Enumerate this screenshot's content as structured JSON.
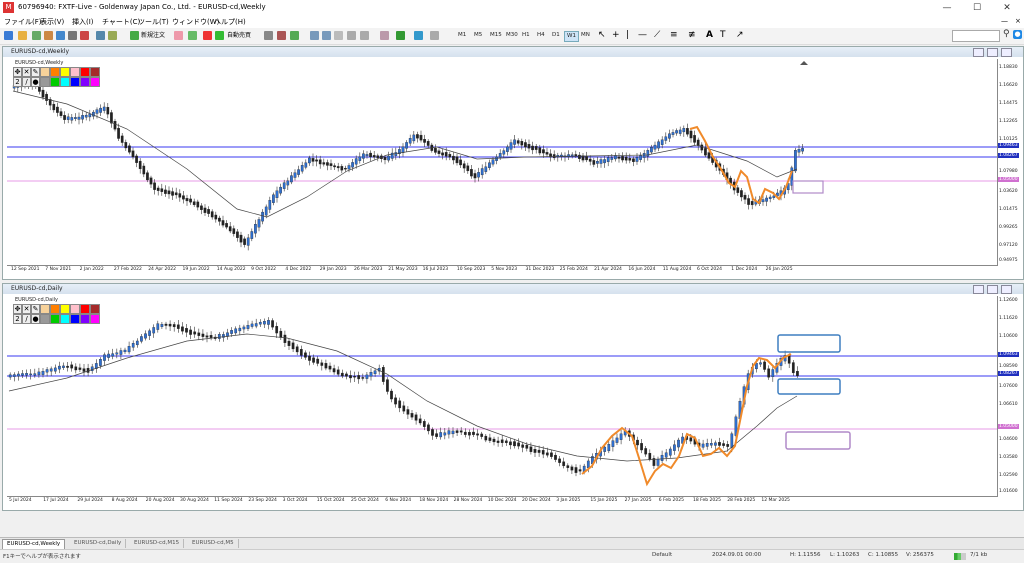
{
  "window": {
    "title": "60796940: FXTF-Live - Goldenway Japan Co., Ltd. - EURUSD-cd,Weekly",
    "controls": [
      "—",
      "☐",
      "✕"
    ]
  },
  "menu": [
    "ファイル(F)",
    "表示(V)",
    "挿入(I)",
    "チャート(C)",
    "ツール(T)",
    "ウィンドウ(W)",
    "ヘルプ(H)"
  ],
  "toolbar": {
    "new_order": "新規注文",
    "auto_trade": "自動売買",
    "timeframes": [
      "M1",
      "M5",
      "M15",
      "M30",
      "H1",
      "H4",
      "D1",
      "W1",
      "MN"
    ],
    "active_timeframe": "W1"
  },
  "weekly": {
    "window_title": "EURUSD-cd,Weekly",
    "symbol_label": "EURUSD-cd,Weekly",
    "price_ticks": [
      "1.18830",
      "1.16620",
      "1.14475",
      "1.12265",
      "1.10125",
      "1.07980",
      "1.05620",
      "1.03620",
      "1.01475",
      "0.99265",
      "0.97120",
      "0.94975"
    ],
    "price_tags": [
      {
        "value": "1.09463",
        "color": "#1f2fbf"
      },
      {
        "value": "1.08267",
        "color": "#1f2fbf"
      },
      {
        "value": "1.05000",
        "color": "#d070d0"
      }
    ],
    "date_ticks": [
      "12 Sep 2021",
      "7 Nov 2021",
      "2 Jan 2022",
      "27 Feb 2022",
      "24 Apr 2022",
      "19 Jun 2022",
      "14 Aug 2022",
      "9 Oct 2022",
      "4 Dec 2022",
      "29 Jan 2023",
      "26 Mar 2023",
      "21 May 2023",
      "16 Jul 2023",
      "10 Sep 2023",
      "5 Nov 2023",
      "31 Dec 2023",
      "25 Feb 2024",
      "21 Apr 2024",
      "16 Jun 2024",
      "11 Aug 2024",
      "6 Oct 2024",
      "1 Dec 2024",
      "26 Jan 2025"
    ]
  },
  "daily": {
    "window_title": "EURUSD-cd,Daily",
    "symbol_label": "EURUSD-cd,Daily",
    "price_ticks": [
      "1.12600",
      "1.11620",
      "1.10600",
      "1.09580",
      "1.08590",
      "1.07600",
      "1.06610",
      "1.05600",
      "1.04600",
      "1.03580",
      "1.02590",
      "1.01600"
    ],
    "price_tags": [
      {
        "value": "1.09463",
        "color": "#1f2fbf"
      },
      {
        "value": "1.08267",
        "color": "#1f2fbf"
      },
      {
        "value": "1.05000",
        "color": "#d070d0"
      }
    ],
    "date_ticks": [
      "5 Jul 2024",
      "17 Jul 2024",
      "29 Jul 2024",
      "8 Aug 2024",
      "20 Aug 2024",
      "30 Aug 2024",
      "11 Sep 2024",
      "23 Sep 2024",
      "3 Oct 2024",
      "15 Oct 2024",
      "25 Oct 2024",
      "6 Nov 2024",
      "18 Nov 2024",
      "28 Nov 2024",
      "10 Dec 2024",
      "20 Dec 2024",
      "3 Jan 2025",
      "15 Jan 2025",
      "27 Jan 2025",
      "6 Feb 2025",
      "18 Feb 2025",
      "28 Feb 2025",
      "12 Mar 2025"
    ]
  },
  "tabs": [
    {
      "label": "EURUSD-cd,Weekly",
      "active": true
    },
    {
      "label": "EURUSD-cd,Daily",
      "active": false
    },
    {
      "label": "EURUSD-cd,M15",
      "active": false
    },
    {
      "label": "EURUSD-cd,M5",
      "active": false
    }
  ],
  "status": {
    "help": "F1キーでヘルプが表示されます",
    "profile": "Default",
    "datetime": "2024.09.01 00:00",
    "high": "H: 1.11556",
    "low": "L: 1.10263",
    "close": "C: 1.10855",
    "volume": "V: 256375",
    "traffic": "7/1 kb"
  }
}
